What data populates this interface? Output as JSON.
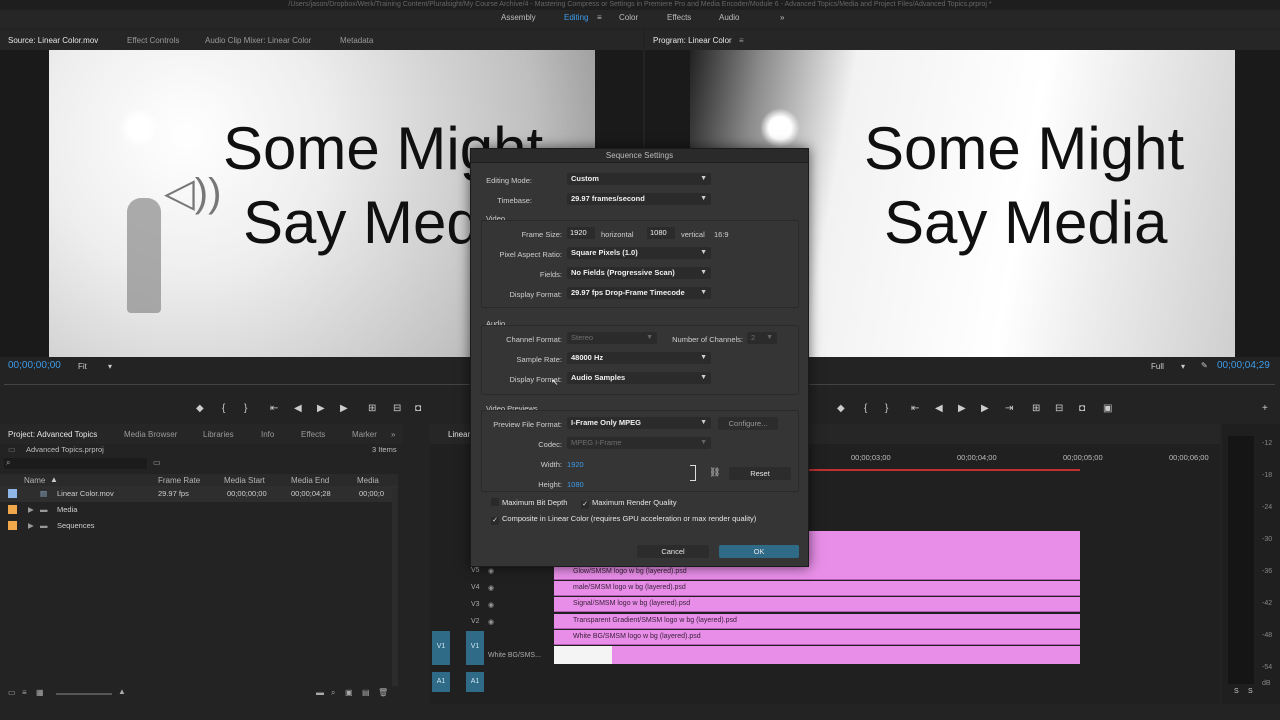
{
  "title_bar": "/Users/jason/Dropbox/Werk/Training Content/Pluralsight/My Course Archive/4 - Mastering Compress or Settings in Premiere Pro and Media Encoder/Module 6 - Advanced Topics/Media and Project Files/Advanced Topics.prproj *",
  "workspaces": [
    "Assembly",
    "Editing",
    "Color",
    "Effects",
    "Audio"
  ],
  "workspace_menu_glyph": "≡",
  "overflow_glyph": "»",
  "source_tabs": [
    "Source: Linear Color.mov",
    "Effect Controls",
    "Audio Clip Mixer: Linear Color",
    "Metadata"
  ],
  "program_tab": "Program: Linear Color",
  "video_caption": {
    "line1": "Some Might",
    "line2": "Say Media"
  },
  "source_timecode": "00;00;00;00",
  "source_zoom": "Fit",
  "program_timecode": "00;00;04;29",
  "program_resolution": "Full",
  "dialog": {
    "title": "Sequence Settings",
    "editing_mode_label": "Editing Mode:",
    "editing_mode": "Custom",
    "timebase_label": "Timebase:",
    "timebase": "29.97  frames/second",
    "video_heading": "Video",
    "frame_size_label": "Frame Size:",
    "frame_w": "1920",
    "horizontal_label": "horizontal",
    "frame_h": "1080",
    "vertical_label": "vertical",
    "aspect": "16:9",
    "par_label": "Pixel Aspect Ratio:",
    "par": "Square Pixels (1.0)",
    "fields_label": "Fields:",
    "fields": "No Fields (Progressive Scan)",
    "display_format_label": "Display Format:",
    "display_format": "29.97 fps Drop-Frame Timecode",
    "audio_heading": "Audio",
    "channel_format_label": "Channel Format:",
    "channel_format": "Stereo",
    "num_channels_label": "Number of Channels:",
    "num_channels": "2",
    "sample_rate_label": "Sample Rate:",
    "sample_rate": "48000 Hz",
    "audio_display_format_label": "Display Format:",
    "audio_display_format": "Audio Samples",
    "previews_heading": "Video Previews",
    "preview_format_label": "Preview File Format:",
    "preview_format": "I-Frame Only MPEG",
    "configure": "Configure...",
    "codec_label": "Codec:",
    "codec": "MPEG I-Frame",
    "width_label": "Width:",
    "width": "1920",
    "height_label": "Height:",
    "height": "1080",
    "reset": "Reset",
    "max_bit_depth": "Maximum Bit Depth",
    "max_render_quality": "Maximum Render Quality",
    "composite_linear": "Composite in Linear Color (requires GPU acceleration or max render quality)",
    "cancel": "Cancel",
    "ok": "OK",
    "check_glyph": "✓"
  },
  "project": {
    "tabs": [
      "Project: Advanced Topics",
      "Media Browser",
      "Libraries",
      "Info",
      "Effects",
      "Marker"
    ],
    "file": "Advanced Topics.prproj",
    "item_count": "3 Items",
    "columns": [
      "Name",
      "Frame Rate",
      "Media Start",
      "Media End",
      "Media Dura"
    ],
    "rows": [
      {
        "name": "Linear Color.mov",
        "rate": "29.97 fps",
        "start": "00;00;00;00",
        "end": "00;00;04;28",
        "dur": "00;00;0",
        "color": "#8fb8e8"
      },
      {
        "name": "Media",
        "rate": "",
        "start": "",
        "end": "",
        "dur": "",
        "color": "#f0a84b"
      },
      {
        "name": "Sequences",
        "rate": "",
        "start": "",
        "end": "",
        "dur": "",
        "color": "#f0a84b"
      }
    ]
  },
  "timeline": {
    "tab": "Linear",
    "ruler": [
      "00;00;03;00",
      "00;00;04;00",
      "00;00;05;00",
      "00;00;06;00"
    ],
    "tracks": [
      {
        "id": "V5",
        "clip": "Glow/SMSM logo w bg (layered).psd"
      },
      {
        "id": "V4",
        "clip": "male/SMSM logo w bg (layered).psd"
      },
      {
        "id": "V3",
        "clip": "Signal/SMSM logo w bg (layered).psd"
      },
      {
        "id": "V2",
        "clip": "Transparent Gradient/SMSM logo w bg (layered).psd"
      },
      {
        "id": "V1",
        "clip": "White BG/SMSM logo w bg (layered).psd"
      }
    ],
    "v1_source": "V1",
    "v1_clip_left": "White BG/SMS...",
    "a1": "A1",
    "clip_color": "#e88ee8"
  },
  "meter_labels": [
    "-12",
    "-18",
    "-24",
    "-30",
    "-36",
    "-42",
    "-48",
    "-54",
    "dB"
  ],
  "meter_solo": [
    "S",
    "S"
  ]
}
